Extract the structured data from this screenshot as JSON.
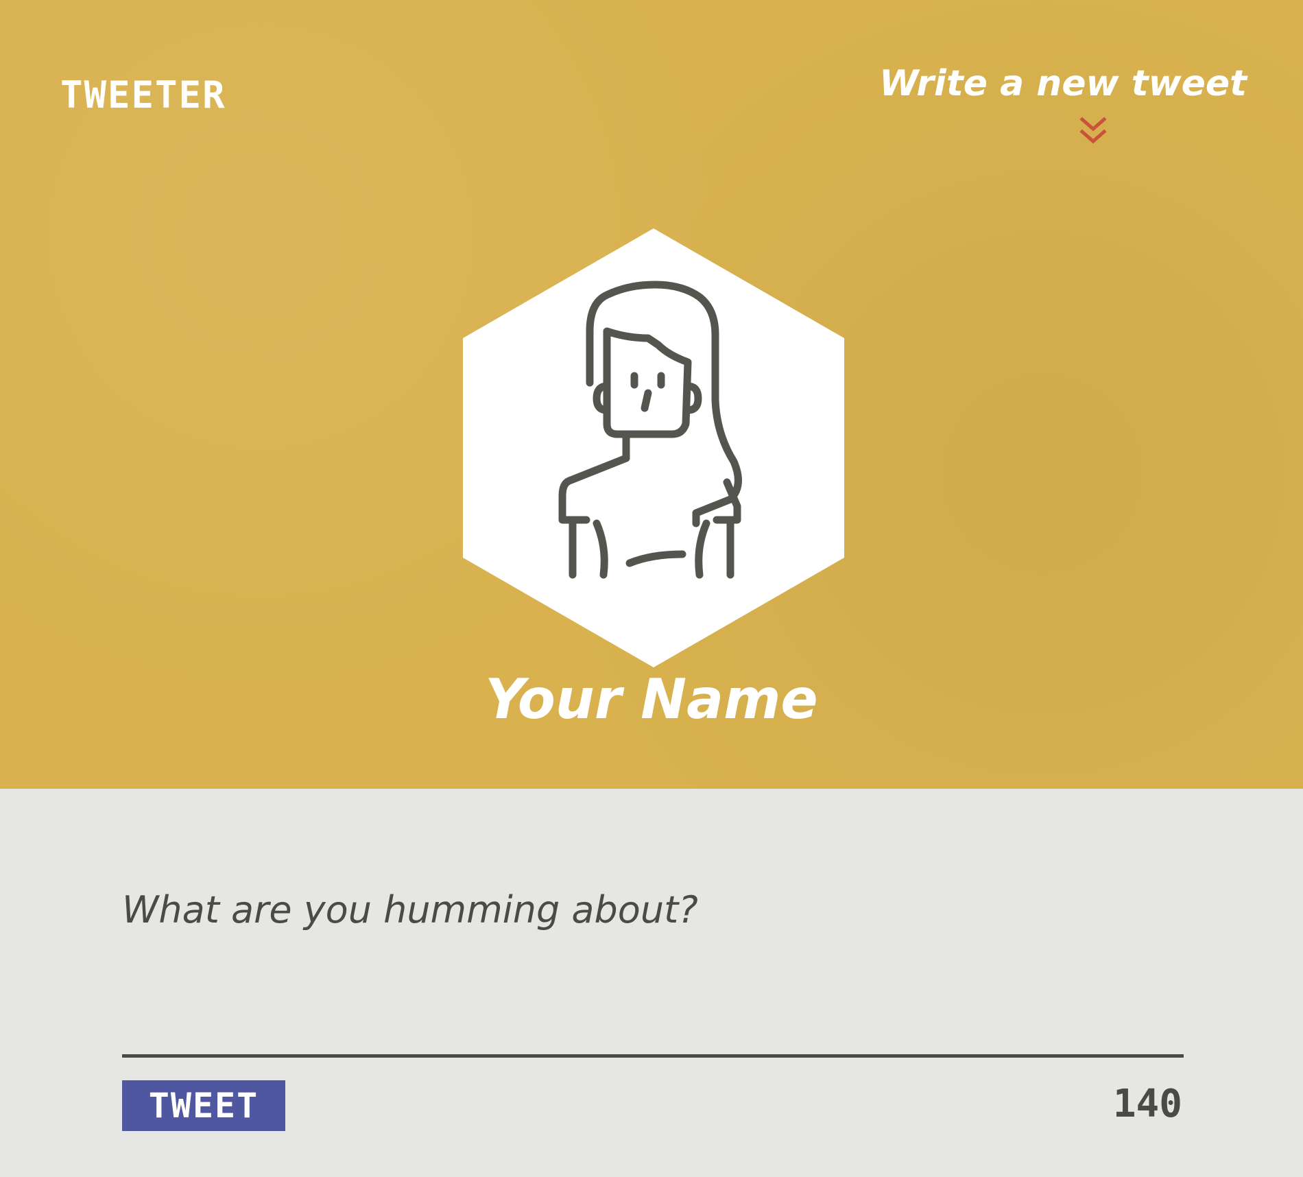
{
  "app": {
    "logo": "TWEETER"
  },
  "header": {
    "write_link": "Write a new tweet",
    "chevron_icon": "double-chevron-down-icon",
    "chevron_color": "#c9523b",
    "background_color": "#d9b24f"
  },
  "profile": {
    "avatar_icon": "woman-avatar-icon",
    "name": "Your Name"
  },
  "composer": {
    "placeholder": "What are you humming about?",
    "value": "",
    "button_label": "TWEET",
    "button_color": "#4e57a0",
    "char_count": "140",
    "background_color": "#e6e6e4"
  }
}
